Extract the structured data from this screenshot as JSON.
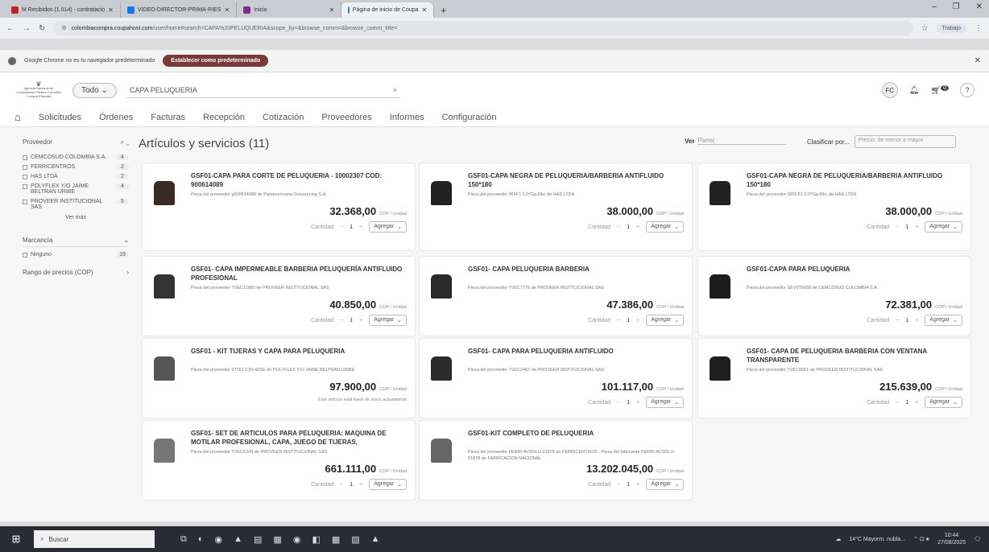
{
  "browser": {
    "tabs": [
      {
        "label": "M  Recibidos (1.014) - contratacio",
        "color": "#c5221f"
      },
      {
        "label": "VIDEO-DIRECTOR-PRIMA-RIES",
        "color": "#1a73e8"
      },
      {
        "label": "Inicio",
        "color": "#7b2d8b"
      },
      {
        "label": "Página de inicio de Coupa",
        "color": "#1a73e8"
      }
    ],
    "url_host": "colombiacompra.coupahost.com",
    "url_path": "/user/home#search=CAPA%20PELUQUERIA&scope_by=&browse_comm=&browse_comm_title=",
    "profile": "Trabajo",
    "info_text": "Google Chrome no es tu navegador predeterminado",
    "info_button": "Establecer como predeterminado"
  },
  "header": {
    "logo_text": "Agencia Nacional de Contratación Pública Colombia Compra Eficiente",
    "scope": "Todo",
    "search_value": "CAPA PELUQUERIA",
    "avatar": "FC",
    "cart_count": "0",
    "help": "?"
  },
  "nav": [
    "Solicitudes",
    "Órdenes",
    "Facturas",
    "Recepción",
    "Cotización",
    "Proveedores",
    "Informes",
    "Configuración"
  ],
  "sidebar": {
    "supplier_title": "Proveedor",
    "suppliers": [
      {
        "name": "CEMCOSUD COLOMBIA S.A.",
        "count": "4"
      },
      {
        "name": "FERRICENTROS",
        "count": "2"
      },
      {
        "name": "HAS LTDA",
        "count": "2"
      },
      {
        "name": "POLYFLEX Y/O JAIME BELTRAN URIBE",
        "count": "4"
      },
      {
        "name": "PROVEER INSTITUCIONAL SAS",
        "count": "5"
      }
    ],
    "see_more": "Ver más",
    "brand_title": "Marcancía",
    "brand_item": {
      "name": "Ninguno",
      "count": "19"
    },
    "price_range": "Rango de precios (COP)"
  },
  "results": {
    "title": "Artículos y servicios (11)",
    "view_label": "Ver",
    "view_value": "Panel",
    "sort_label": "Clasificar por...",
    "sort_value": "Precio: de menor a mayor"
  },
  "labels": {
    "qty": "Cantidad",
    "add": "Agregar",
    "unit": "COP / Unidad"
  },
  "items": [
    {
      "title": "GSF01-CAPA PARA CORTE DE PELUQUERIA - 10002307 cod: 900614089",
      "supplier": "Pieza del proveedor g900614089 de Panamericana Outsourcing S.A.",
      "price": "32.368,00",
      "qty": "1",
      "stock": ""
    },
    {
      "title": "gsf01-CAPA NEGRA DE PELUQUERIA/BARBERIA ANTIFLUIDO 150*180",
      "supplier": "Pieza del proveedor 065F1 CJYGpJ0kc de HAS LTDA",
      "price": "38.000,00",
      "qty": "1",
      "stock": ""
    },
    {
      "title": "gsf01-CAPA NEGRA DE PELUQUERIA/BARBERIA ANTIFLUIDO 150*180",
      "supplier": "Pieza del proveedor 065CF1 CJYGpJ0kc de HAS LTDA",
      "price": "38.000,00",
      "qty": "1",
      "stock": ""
    },
    {
      "title": "GSF01- CAPA IMPERMEABLE BARBERIA PELUQUERÍA ANTIFLUIDO PROFESIONAL",
      "supplier": "Pieza del proveedor TVEC11882 de PROVEER INSTITUCIONAL SAS",
      "price": "40.850,00",
      "qty": "1",
      "stock": ""
    },
    {
      "title": "GSF01- CAPA PELUQUERIA BARBERIA",
      "supplier": "Pieza del proveedor TVEC7776 de PROVEER INSTITUCIONAL SAS",
      "price": "47.386,00",
      "qty": "1",
      "stock": ""
    },
    {
      "title": "GSF01-CAPA PARA PELUQUERIA",
      "supplier": "Pieza del proveedor SEV0T5058 de CEMCOSUD COLOMBIA S.A.",
      "price": "72.381,00",
      "qty": "1",
      "stock": ""
    },
    {
      "title": "GSF01 - KIT TIJERAS Y CAPA PARA PELUQUERIA",
      "supplier": "Pieza del proveedor 27761 C25-42SE de POLYFLEX Y/O JAIME BELTRAN URIBE",
      "price": "97.900,00",
      "qty": "",
      "stock": "Este artículo está fuera de stock actualmente"
    },
    {
      "title": "GSF01- CAPA PARA PELUQUERIA ANTIFLUIDO",
      "supplier": "Pieza del proveedor TVEC2467 de PROVEER INSTITUCIONAL SAS",
      "price": "101.117,00",
      "qty": "1",
      "stock": ""
    },
    {
      "title": "GSF01- CAPA DE PELUQUERIA BARBERIA CON VENTANA TRANSPARENTE",
      "supplier": "Pieza del proveedor TVEC6651 de PROVEER INSTITUCIONAL SAS",
      "price": "215.639,00",
      "qty": "1",
      "stock": ""
    },
    {
      "title": "GSF01- SET DE ARTICULOS PARA PELUQUERIA: MAQUINA DE MOTILAR PROFESIONAL, CAPA, JUEGO DE TIJERAS,",
      "supplier": "Pieza del proveedor TVEC5249 de PROVEER INSTITUCIONAL SAS",
      "price": "661.111,00",
      "qty": "1",
      "stock": ""
    },
    {
      "title": "gsf01-KIT COMPLETO DE PELUQUERIA",
      "supplier": "Pieza del proveedor FERRI-AVSOLU-01878 de FERRICENTROS  ·  Pieza del fabricante FERRI-AVSOLU-01878 de FABRICACION NACIONAL",
      "price": "13.202.045,00",
      "qty": "1",
      "stock": ""
    }
  ],
  "taskbar": {
    "search": "Buscar",
    "weather": "14°C Mayorm. nubla...",
    "time": "10:44",
    "date": "27/08/2025"
  }
}
